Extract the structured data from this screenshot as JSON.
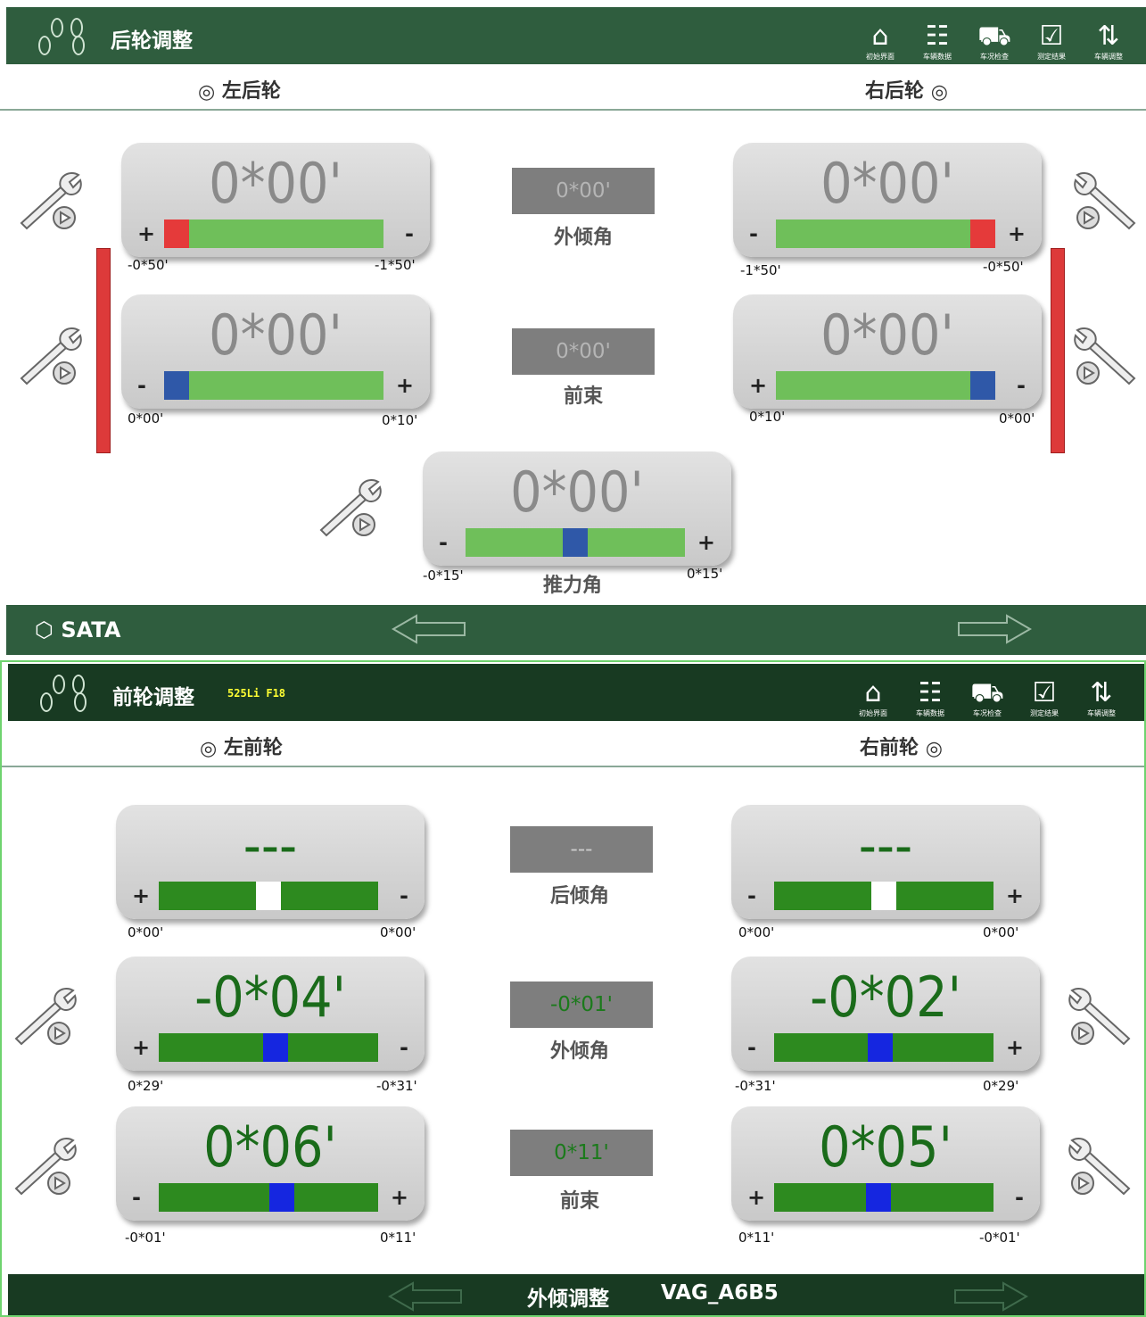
{
  "top": {
    "title": "后轮调整",
    "nav": [
      {
        "icon": "home-icon",
        "label": "初始界面"
      },
      {
        "icon": "vehicle-data-icon",
        "label": "车辆数据"
      },
      {
        "icon": "vehicle-check-icon",
        "label": "车况检查"
      },
      {
        "icon": "measure-result-icon",
        "label": "测定结果"
      },
      {
        "icon": "vehicle-adjust-icon",
        "label": "车辆调整"
      }
    ],
    "left_header": "左后轮",
    "right_header": "右后轮",
    "camber": {
      "label": "外倾角",
      "mid": "0*00'",
      "left": {
        "value": "0*00'",
        "min": "-0*50'",
        "max": "-1*50'",
        "sign_l": "+",
        "sign_r": "-"
      },
      "right": {
        "value": "0*00'",
        "min": "-1*50'",
        "max": "-0*50'",
        "sign_l": "-",
        "sign_r": "+"
      }
    },
    "toe": {
      "label": "前束",
      "mid": "0*00'",
      "left": {
        "value": "0*00'",
        "min": "0*00'",
        "max": "0*10'",
        "sign_l": "-",
        "sign_r": "+"
      },
      "right": {
        "value": "0*00'",
        "min": "0*10'",
        "max": "0*00'",
        "sign_l": "+",
        "sign_r": "-"
      }
    },
    "thrust": {
      "label": "推力角",
      "value": "0*00'",
      "min": "-0*15'",
      "max": "0*15'",
      "sign_l": "-",
      "sign_r": "+"
    },
    "logo": "SATA"
  },
  "bottom": {
    "title": "前轮调整",
    "subtitle": "525Li F18",
    "nav": [
      {
        "icon": "home-icon",
        "label": "初始界面"
      },
      {
        "icon": "vehicle-data-icon",
        "label": "车辆数据"
      },
      {
        "icon": "vehicle-check-icon",
        "label": "车况检查"
      },
      {
        "icon": "measure-result-icon",
        "label": "测定结果"
      },
      {
        "icon": "vehicle-adjust-icon",
        "label": "车辆调整"
      }
    ],
    "left_header": "左前轮",
    "right_header": "右前轮",
    "caster": {
      "label": "后倾角",
      "mid": "---",
      "left": {
        "value": "---",
        "min": "0*00'",
        "max": "0*00'",
        "sign_l": "+",
        "sign_r": "-"
      },
      "right": {
        "value": "---",
        "min": "0*00'",
        "max": "0*00'",
        "sign_l": "-",
        "sign_r": "+"
      }
    },
    "camber": {
      "label": "外倾角",
      "mid": "-0*01'",
      "left": {
        "value": "-0*04'",
        "min": "0*29'",
        "max": "-0*31'",
        "sign_l": "+",
        "sign_r": "-"
      },
      "right": {
        "value": "-0*02'",
        "min": "-0*31'",
        "max": "0*29'",
        "sign_l": "-",
        "sign_r": "+"
      }
    },
    "toe": {
      "label": "前束",
      "mid": "0*11'",
      "left": {
        "value": "0*06'",
        "min": "-0*01'",
        "max": "0*11'",
        "sign_l": "-",
        "sign_r": "+"
      },
      "right": {
        "value": "0*05'",
        "min": "0*11'",
        "max": "-0*01'",
        "sign_l": "+",
        "sign_r": "-"
      }
    },
    "footer_mode": "外倾调整",
    "footer_vehicle": "VAG_A6B5"
  }
}
